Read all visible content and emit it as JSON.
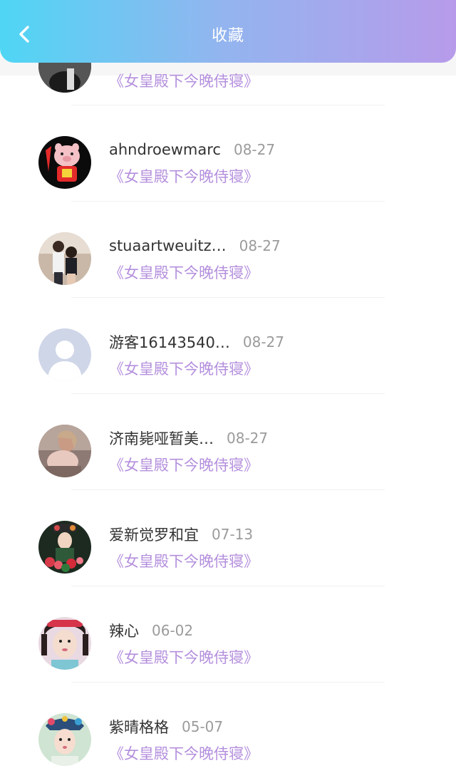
{
  "header": {
    "title": "收藏",
    "back_icon": "chevron-left-icon",
    "gradient": [
      "#4fd6f4",
      "#b79bea"
    ]
  },
  "favorites": [
    {
      "name": "",
      "date": "",
      "book": "《女皇殿下今晚侍寝》",
      "avatar": "dark-photo"
    },
    {
      "name": "ahndroewmarc",
      "date": "08-27",
      "book": "《女皇殿下今晚侍寝》",
      "avatar": "cartoon-pig"
    },
    {
      "name": "stuaartweuitz…",
      "date": "08-27",
      "book": "《女皇殿下今晚侍寝》",
      "avatar": "couple-photo"
    },
    {
      "name": "游客16143540…",
      "date": "08-27",
      "book": "《女皇殿下今晚侍寝》",
      "avatar": "default-user"
    },
    {
      "name": "济南毙哑暂美…",
      "date": "08-27",
      "book": "《女皇殿下今晚侍寝》",
      "avatar": "girl-photo"
    },
    {
      "name": "爱新觉罗和宜",
      "date": "07-13",
      "book": "《女皇殿下今晚侍寝》",
      "avatar": "costume-flowers"
    },
    {
      "name": "辣心",
      "date": "06-02",
      "book": "《女皇殿下今晚侍寝》",
      "avatar": "costume-girl"
    },
    {
      "name": "紫晴格格",
      "date": "05-07",
      "book": "《女皇殿下今晚侍寝》",
      "avatar": "costume-headdress"
    }
  ],
  "colors": {
    "book_title": "#b48fdd",
    "name": "#333333",
    "date": "#9b9b9b"
  }
}
